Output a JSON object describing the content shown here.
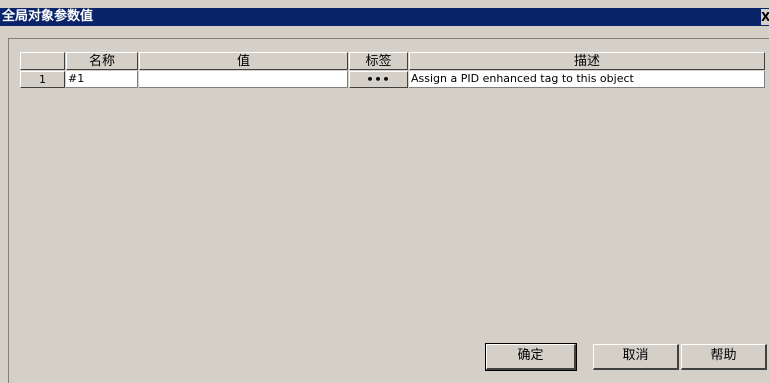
{
  "window": {
    "title": "全局对象参数值",
    "close_glyph": "X"
  },
  "grid": {
    "columns": [
      "",
      "名称",
      "值",
      "标签",
      "描述"
    ],
    "rows": [
      {
        "index": "1",
        "name": "#1",
        "value": "",
        "tag": "•••",
        "description": "Assign a PID enhanced tag to this object"
      }
    ]
  },
  "buttons": {
    "ok": "确定",
    "cancel": "取消",
    "help": "帮助"
  }
}
